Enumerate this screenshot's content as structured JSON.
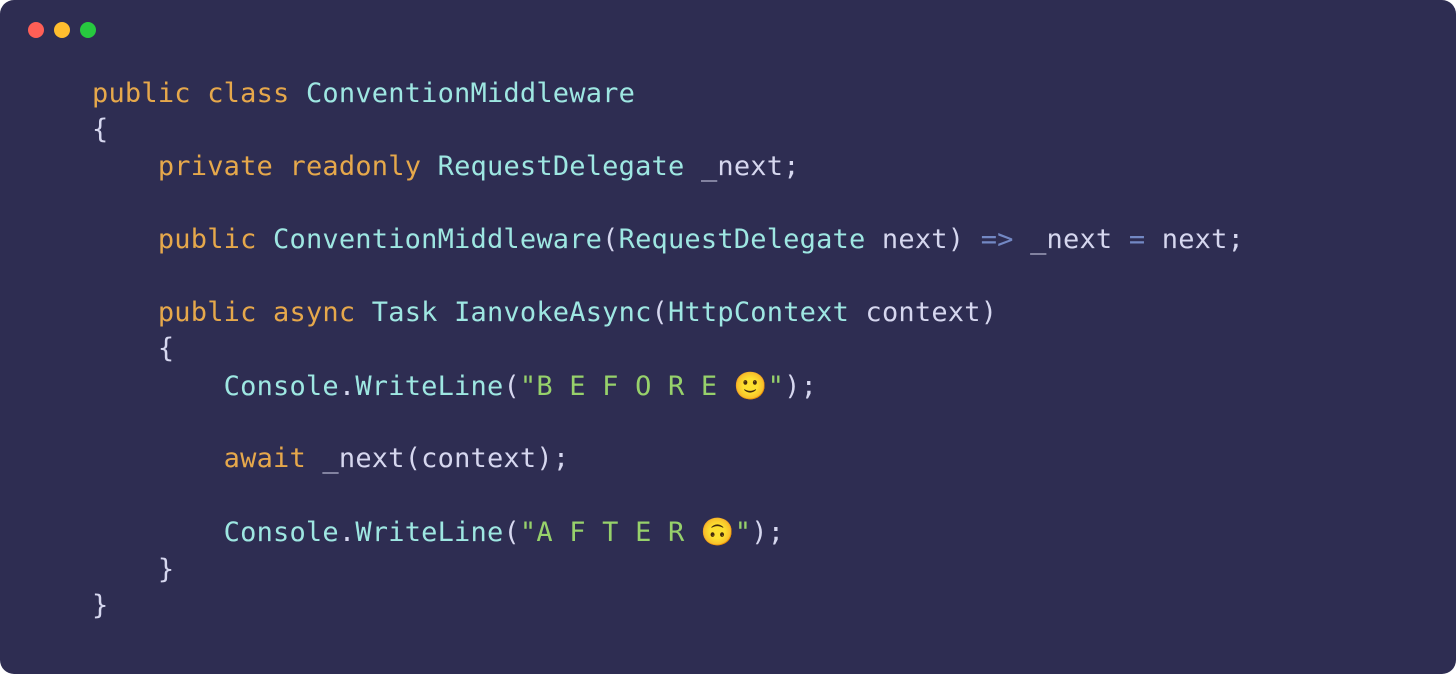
{
  "window": {
    "dots": [
      "red",
      "yellow",
      "green"
    ]
  },
  "code": {
    "tokens": {
      "public": "public",
      "class": "class",
      "private": "private",
      "readonly": "readonly",
      "async": "async",
      "await": "await",
      "ConventionMiddleware": "ConventionMiddleware",
      "RequestDelegate": "RequestDelegate",
      "_next": "_next",
      "next": "next",
      "arrow": "=>",
      "eq": "=",
      "Task": "Task",
      "IanvokeAsync": "IanvokeAsync",
      "HttpContext": "HttpContext",
      "context": "context",
      "Console": "Console",
      "WriteLine": "WriteLine",
      "before_str_open": "\"B E F O R E ",
      "before_emoji": "🙂",
      "before_str_close": "\"",
      "after_str_open": "\"A F T E R ",
      "after_emoji": "🙃",
      "after_str_close": "\"",
      "lbrace": "{",
      "rbrace": "}",
      "lparen": "(",
      "rparen": ")",
      "semi": ";",
      "dot": "."
    }
  }
}
